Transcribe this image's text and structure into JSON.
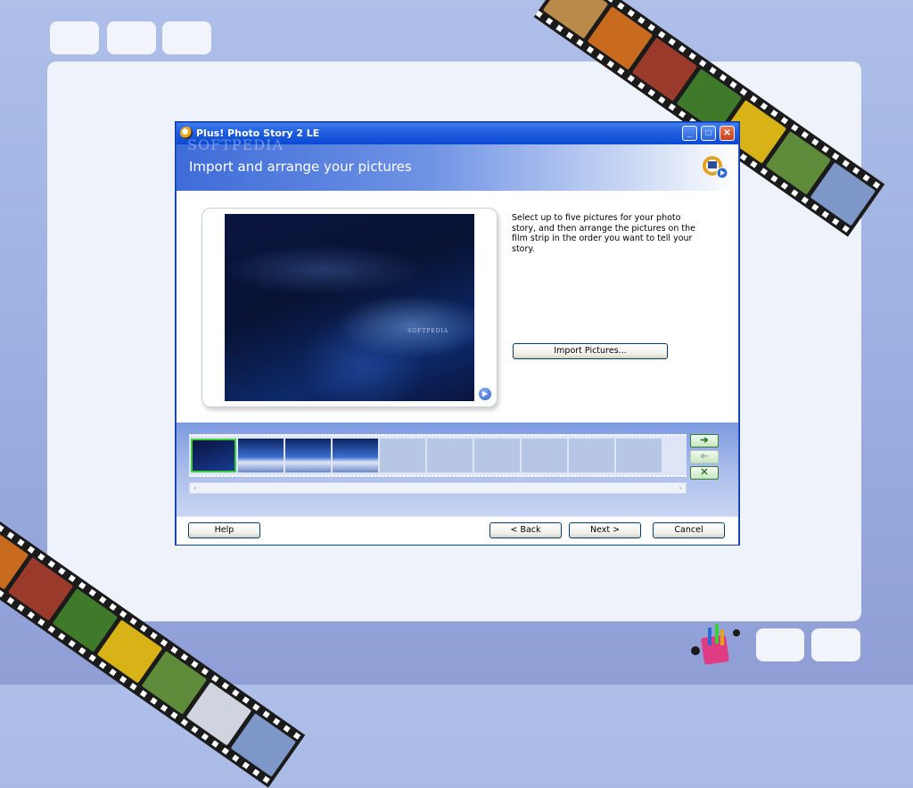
{
  "window": {
    "title": "Plus! Photo Story 2 LE"
  },
  "header": {
    "title": "Import and arrange your pictures",
    "watermark": "SOFTPEDIA"
  },
  "preview": {
    "watermark": "SOFTPEDIA",
    "play_icon": "play-icon"
  },
  "instructions": "Select up to five pictures for your photo story, and then arrange the pictures on the film strip in the order you want to tell your story.",
  "buttons": {
    "import": "Import Pictures...",
    "help": "Help",
    "back": "< Back",
    "next": "Next >",
    "cancel": "Cancel"
  },
  "filmstrip": {
    "slots_total": 10,
    "pictures": 4,
    "selected_index": 0,
    "move_right_icon": "arrow-right-icon",
    "move_left_icon": "arrow-left-icon",
    "remove_icon": "x-icon"
  },
  "colors": {
    "accent": "#0a49d3",
    "selected_border": "#3ccc3c"
  }
}
